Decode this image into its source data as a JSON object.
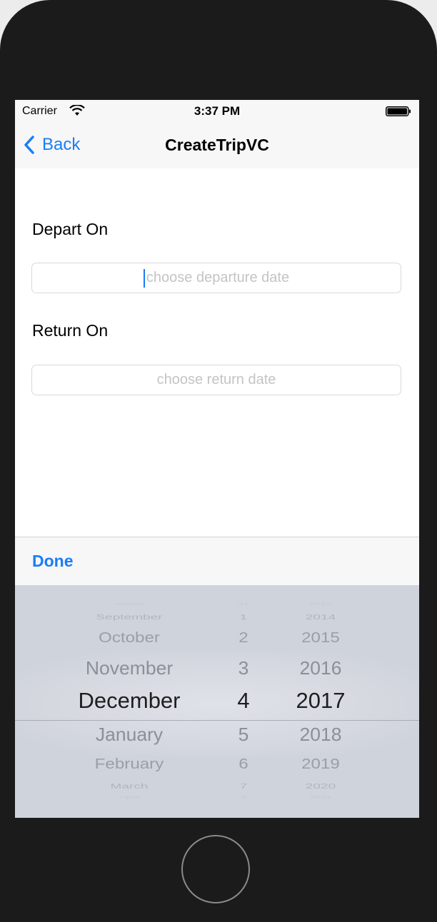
{
  "status_bar": {
    "carrier": "Carrier",
    "time": "3:37 PM"
  },
  "nav": {
    "back_label": "Back",
    "title": "CreateTripVC"
  },
  "form": {
    "depart_label": "Depart On",
    "depart_placeholder": "choose departure date",
    "depart_value": "",
    "return_label": "Return On",
    "return_placeholder": "choose return date",
    "return_value": ""
  },
  "toolbar": {
    "done_label": "Done"
  },
  "picker": {
    "months": [
      "August",
      "September",
      "October",
      "November",
      "December",
      "January",
      "February",
      "March",
      "April"
    ],
    "days": [
      "31",
      "1",
      "2",
      "3",
      "4",
      "5",
      "6",
      "7",
      "8"
    ],
    "years": [
      "2013",
      "2014",
      "2015",
      "2016",
      "2017",
      "2018",
      "2019",
      "2020",
      "2021"
    ],
    "selected": {
      "month": "December",
      "day": "4",
      "year": "2017"
    }
  },
  "colors": {
    "accent": "#1a7df6",
    "picker_bg": "#cfd3db",
    "phone_body": "#1b1b1c"
  }
}
